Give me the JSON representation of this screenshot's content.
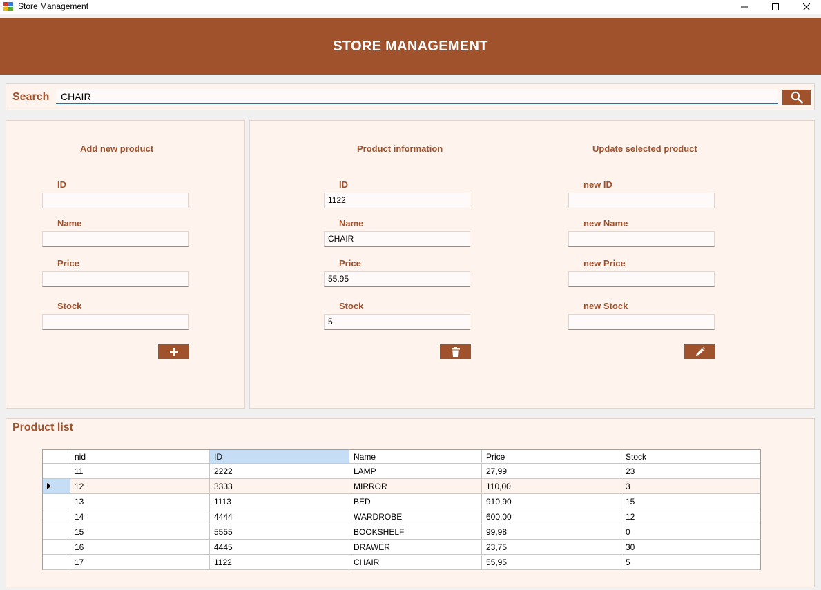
{
  "window": {
    "title": "Store Management"
  },
  "header": {
    "title": "STORE MANAGEMENT"
  },
  "search": {
    "label": "Search",
    "value": "CHAIR"
  },
  "add": {
    "title": "Add new product",
    "id_label": "ID",
    "name_label": "Name",
    "price_label": "Price",
    "stock_label": "Stock",
    "id_value": "",
    "name_value": "",
    "price_value": "",
    "stock_value": ""
  },
  "info": {
    "title": "Product information",
    "id_label": "ID",
    "name_label": "Name",
    "price_label": "Price",
    "stock_label": "Stock",
    "id_value": "1122",
    "name_value": "CHAIR",
    "price_value": "55,95",
    "stock_value": "5"
  },
  "update": {
    "title": "Update selected product",
    "id_label": "new ID",
    "name_label": "new Name",
    "price_label": "new Price",
    "stock_label": "new Stock",
    "id_value": "",
    "name_value": "",
    "price_value": "",
    "stock_value": ""
  },
  "list": {
    "title": "Product list",
    "columns": [
      "nid",
      "ID",
      "Name",
      "Price",
      "Stock"
    ],
    "selected_column": 1,
    "selected_row": 1,
    "rows": [
      [
        "11",
        "2222",
        "LAMP",
        "27,99",
        "23"
      ],
      [
        "12",
        "3333",
        "MIRROR",
        "110,00",
        "3"
      ],
      [
        "13",
        "1113",
        "BED",
        "910,90",
        "15"
      ],
      [
        "14",
        "4444",
        "WARDROBE",
        "600,00",
        "12"
      ],
      [
        "15",
        "5555",
        "BOOKSHELF",
        "99,98",
        "0"
      ],
      [
        "16",
        "4445",
        "DRAWER",
        "23,75",
        "30"
      ],
      [
        "17",
        "1122",
        "CHAIR",
        "55,95",
        "5"
      ]
    ]
  },
  "colors": {
    "accent": "#a0522d",
    "panel": "#fff3ed",
    "selected_row": "#fff3ed",
    "selected_header": "#c5def5"
  }
}
